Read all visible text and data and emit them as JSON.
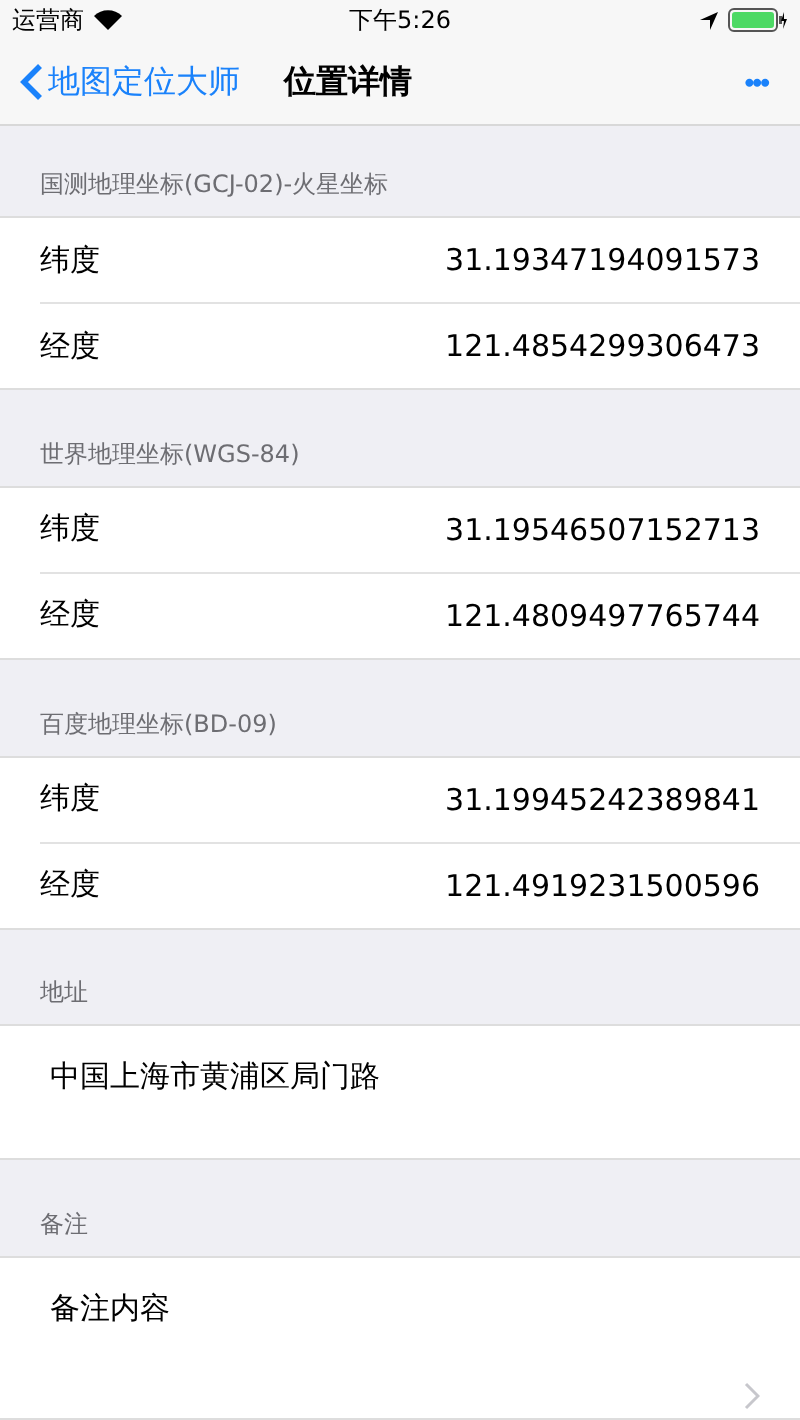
{
  "status_bar": {
    "carrier": "运营商",
    "time": "下午5:26"
  },
  "nav": {
    "back": "地图定位大师",
    "title": "位置详情",
    "more": "•••"
  },
  "sections": [
    {
      "kind": "pairs",
      "header": "国测地理坐标(GCJ-02)-火星坐标",
      "rows": [
        {
          "label": "纬度",
          "value": "31.19347194091573"
        },
        {
          "label": "经度",
          "value": "121.4854299306473"
        }
      ]
    },
    {
      "kind": "pairs",
      "header": "世界地理坐标(WGS-84)",
      "rows": [
        {
          "label": "纬度",
          "value": "31.19546507152713"
        },
        {
          "label": "经度",
          "value": "121.4809497765744"
        }
      ]
    },
    {
      "kind": "pairs",
      "header": "百度地理坐标(BD-09)",
      "rows": [
        {
          "label": "纬度",
          "value": "31.19945242389841"
        },
        {
          "label": "经度",
          "value": "121.4919231500596"
        }
      ]
    },
    {
      "kind": "text",
      "header": "地址",
      "text": "中国上海市黄浦区局门路"
    },
    {
      "kind": "note",
      "header": "备注",
      "text": "备注内容"
    }
  ]
}
